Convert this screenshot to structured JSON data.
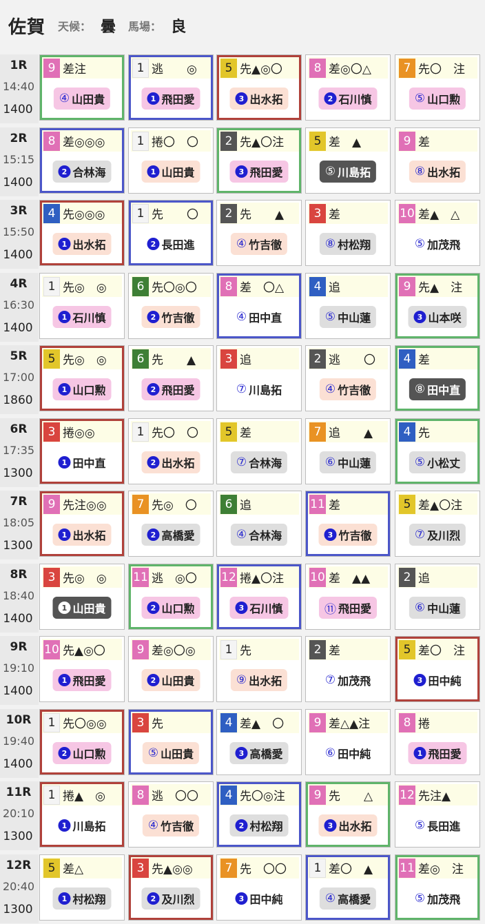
{
  "header": {
    "venue": "佐賀",
    "weather_label": "天候：",
    "weather": "曇",
    "track_label": "馬場：",
    "track": "良"
  },
  "races": [
    {
      "num": "1R",
      "time": "14:40",
      "dist": "1400",
      "entries": [
        {
          "frame": "green",
          "post": "9",
          "marks": "差注",
          "jockey_num": "④",
          "circle": "open",
          "jockey": "山田貴",
          "bg": "pink"
        },
        {
          "frame": "blue",
          "post": "1",
          "marks": "逃　　◎",
          "jockey_num": "1",
          "circle": "solid",
          "jockey": "飛田愛",
          "bg": "pink"
        },
        {
          "frame": "red",
          "post": "5",
          "marks": "先▲◎〇",
          "jockey_num": "3",
          "circle": "solid",
          "jockey": "出水拓",
          "bg": "peach"
        },
        {
          "frame": "none",
          "post": "8",
          "marks": "差◎〇△",
          "jockey_num": "2",
          "circle": "solid",
          "jockey": "石川慎",
          "bg": "pink"
        },
        {
          "frame": "none",
          "post": "7",
          "marks": "先〇　注",
          "jockey_num": "⑤",
          "circle": "open",
          "jockey": "山口勲",
          "bg": "pink"
        }
      ]
    },
    {
      "num": "2R",
      "time": "15:15",
      "dist": "1400",
      "entries": [
        {
          "frame": "blue",
          "post": "8",
          "marks": "差◎◎◎",
          "jockey_num": "2",
          "circle": "solid",
          "jockey": "合林海",
          "bg": "gray"
        },
        {
          "frame": "none",
          "post": "1",
          "marks": "捲〇　〇",
          "jockey_num": "1",
          "circle": "solid",
          "jockey": "山田貴",
          "bg": "peach"
        },
        {
          "frame": "green",
          "post": "2",
          "marks": "先▲〇注",
          "jockey_num": "3",
          "circle": "solid",
          "jockey": "飛田愛",
          "bg": "pink"
        },
        {
          "frame": "none",
          "post": "5",
          "marks": "差　▲",
          "jockey_num": "⑤",
          "circle": "open",
          "jockey": "川島拓",
          "bg": "dark"
        },
        {
          "frame": "none",
          "post": "9",
          "marks": "差",
          "jockey_num": "⑧",
          "circle": "open",
          "jockey": "出水拓",
          "bg": "peach"
        }
      ]
    },
    {
      "num": "3R",
      "time": "15:50",
      "dist": "1400",
      "entries": [
        {
          "frame": "red",
          "post": "4",
          "marks": "先◎◎◎",
          "jockey_num": "1",
          "circle": "solid",
          "jockey": "出水拓",
          "bg": "peach"
        },
        {
          "frame": "blue",
          "post": "1",
          "marks": "先　　〇",
          "jockey_num": "2",
          "circle": "solid",
          "jockey": "長田進",
          "bg": "white"
        },
        {
          "frame": "none",
          "post": "2",
          "marks": "先　　▲",
          "jockey_num": "④",
          "circle": "open",
          "jockey": "竹吉徹",
          "bg": "peach"
        },
        {
          "frame": "none",
          "post": "3",
          "marks": "差",
          "jockey_num": "⑧",
          "circle": "open",
          "jockey": "村松翔",
          "bg": "gray"
        },
        {
          "frame": "none",
          "post": "10",
          "marks": "差▲　△",
          "jockey_num": "⑤",
          "circle": "open",
          "jockey": "加茂飛",
          "bg": "none"
        }
      ]
    },
    {
      "num": "4R",
      "time": "16:30",
      "dist": "1400",
      "entries": [
        {
          "frame": "none",
          "post": "1",
          "marks": "先◎　◎",
          "jockey_num": "1",
          "circle": "solid",
          "jockey": "石川慎",
          "bg": "pink"
        },
        {
          "frame": "none",
          "post": "6",
          "marks": "先〇◎〇",
          "jockey_num": "2",
          "circle": "solid",
          "jockey": "竹吉徹",
          "bg": "peach"
        },
        {
          "frame": "blue",
          "post": "8",
          "marks": "差　〇△",
          "jockey_num": "④",
          "circle": "open",
          "jockey": "田中直",
          "bg": "white"
        },
        {
          "frame": "none",
          "post": "4",
          "marks": "追",
          "jockey_num": "⑤",
          "circle": "open",
          "jockey": "中山蓮",
          "bg": "gray"
        },
        {
          "frame": "green",
          "post": "9",
          "marks": "先▲　注",
          "jockey_num": "3",
          "circle": "solid",
          "jockey": "山本咲",
          "bg": "gray"
        }
      ]
    },
    {
      "num": "5R",
      "time": "17:00",
      "dist": "1860",
      "entries": [
        {
          "frame": "red",
          "post": "5",
          "marks": "先◎　◎",
          "jockey_num": "1",
          "circle": "solid",
          "jockey": "山口勲",
          "bg": "pink"
        },
        {
          "frame": "none",
          "post": "6",
          "marks": "先　　▲",
          "jockey_num": "2",
          "circle": "solid",
          "jockey": "飛田愛",
          "bg": "pink"
        },
        {
          "frame": "none",
          "post": "3",
          "marks": "追",
          "jockey_num": "⑦",
          "circle": "open",
          "jockey": "川島拓",
          "bg": "none"
        },
        {
          "frame": "none",
          "post": "2",
          "marks": "逃　　〇",
          "jockey_num": "④",
          "circle": "open",
          "jockey": "竹吉徹",
          "bg": "peach"
        },
        {
          "frame": "green",
          "post": "4",
          "marks": "差",
          "jockey_num": "⑧",
          "circle": "open",
          "jockey": "田中直",
          "bg": "dark"
        }
      ]
    },
    {
      "num": "6R",
      "time": "17:35",
      "dist": "1300",
      "entries": [
        {
          "frame": "red",
          "post": "3",
          "marks": "捲◎◎",
          "jockey_num": "1",
          "circle": "solid",
          "jockey": "田中直",
          "bg": "white"
        },
        {
          "frame": "none",
          "post": "1",
          "marks": "先〇　〇",
          "jockey_num": "2",
          "circle": "solid",
          "jockey": "出水拓",
          "bg": "peach"
        },
        {
          "frame": "none",
          "post": "5",
          "marks": "差",
          "jockey_num": "⑦",
          "circle": "open",
          "jockey": "合林海",
          "bg": "gray"
        },
        {
          "frame": "none",
          "post": "7",
          "marks": "追　　▲",
          "jockey_num": "⑥",
          "circle": "open",
          "jockey": "中山蓮",
          "bg": "gray"
        },
        {
          "frame": "green",
          "post": "4",
          "marks": "先",
          "jockey_num": "⑤",
          "circle": "open",
          "jockey": "小松丈",
          "bg": "gray"
        }
      ]
    },
    {
      "num": "7R",
      "time": "18:05",
      "dist": "1300",
      "entries": [
        {
          "frame": "red",
          "post": "9",
          "marks": "先注◎◎",
          "jockey_num": "1",
          "circle": "solid",
          "jockey": "出水拓",
          "bg": "peach"
        },
        {
          "frame": "none",
          "post": "7",
          "marks": "先◎　〇",
          "jockey_num": "2",
          "circle": "solid",
          "jockey": "高橋愛",
          "bg": "gray"
        },
        {
          "frame": "none",
          "post": "6",
          "marks": "追",
          "jockey_num": "④",
          "circle": "open",
          "jockey": "合林海",
          "bg": "gray"
        },
        {
          "frame": "blue",
          "post": "11",
          "marks": "差",
          "jockey_num": "3",
          "circle": "solid",
          "jockey": "竹吉徹",
          "bg": "peach"
        },
        {
          "frame": "none",
          "post": "5",
          "marks": "差▲〇注",
          "jockey_num": "⑦",
          "circle": "open",
          "jockey": "及川烈",
          "bg": "gray"
        }
      ]
    },
    {
      "num": "8R",
      "time": "18:40",
      "dist": "1400",
      "entries": [
        {
          "frame": "none",
          "post": "3",
          "marks": "先◎　◎",
          "jockey_num": "1",
          "circle": "solid",
          "jockey": "山田貴",
          "bg": "dark"
        },
        {
          "frame": "green",
          "post": "11",
          "marks": "逃　◎〇",
          "jockey_num": "2",
          "circle": "solid",
          "jockey": "山口勲",
          "bg": "pink"
        },
        {
          "frame": "blue",
          "post": "12",
          "marks": "捲▲〇注",
          "jockey_num": "3",
          "circle": "solid",
          "jockey": "石川慎",
          "bg": "pink"
        },
        {
          "frame": "none",
          "post": "10",
          "marks": "差　▲▲",
          "jockey_num": "⑪",
          "circle": "open",
          "jockey": "飛田愛",
          "bg": "pink"
        },
        {
          "frame": "none",
          "post": "2",
          "marks": "追",
          "jockey_num": "⑥",
          "circle": "open",
          "jockey": "中山蓮",
          "bg": "gray"
        }
      ]
    },
    {
      "num": "9R",
      "time": "19:10",
      "dist": "1400",
      "entries": [
        {
          "frame": "none",
          "post": "10",
          "marks": "先▲◎〇",
          "jockey_num": "1",
          "circle": "solid",
          "jockey": "飛田愛",
          "bg": "pink"
        },
        {
          "frame": "none",
          "post": "9",
          "marks": "差◎〇◎",
          "jockey_num": "2",
          "circle": "solid",
          "jockey": "山田貴",
          "bg": "peach"
        },
        {
          "frame": "none",
          "post": "1",
          "marks": "先",
          "jockey_num": "⑨",
          "circle": "open",
          "jockey": "出水拓",
          "bg": "peach"
        },
        {
          "frame": "none",
          "post": "2",
          "marks": "差",
          "jockey_num": "⑦",
          "circle": "open",
          "jockey": "加茂飛",
          "bg": "none"
        },
        {
          "frame": "red",
          "post": "5",
          "marks": "差〇　注",
          "jockey_num": "3",
          "circle": "solid",
          "jockey": "田中純",
          "bg": "white"
        }
      ]
    },
    {
      "num": "10R",
      "time": "19:40",
      "dist": "1400",
      "entries": [
        {
          "frame": "red",
          "post": "1",
          "marks": "先〇◎◎",
          "jockey_num": "2",
          "circle": "solid",
          "jockey": "山口勲",
          "bg": "pink"
        },
        {
          "frame": "blue",
          "post": "3",
          "marks": "先",
          "jockey_num": "⑤",
          "circle": "open",
          "jockey": "山田貴",
          "bg": "peach"
        },
        {
          "frame": "none",
          "post": "4",
          "marks": "差▲　〇",
          "jockey_num": "3",
          "circle": "solid",
          "jockey": "高橋愛",
          "bg": "gray"
        },
        {
          "frame": "none",
          "post": "9",
          "marks": "差△▲注",
          "jockey_num": "⑥",
          "circle": "open",
          "jockey": "田中純",
          "bg": "none"
        },
        {
          "frame": "none",
          "post": "8",
          "marks": "捲",
          "jockey_num": "1",
          "circle": "solid",
          "jockey": "飛田愛",
          "bg": "pink"
        }
      ]
    },
    {
      "num": "11R",
      "time": "20:10",
      "dist": "1300",
      "entries": [
        {
          "frame": "red",
          "post": "1",
          "marks": "捲▲　◎",
          "jockey_num": "1",
          "circle": "solid",
          "jockey": "川島拓",
          "bg": "white"
        },
        {
          "frame": "none",
          "post": "8",
          "marks": "逃　〇〇",
          "jockey_num": "④",
          "circle": "open",
          "jockey": "竹吉徹",
          "bg": "peach"
        },
        {
          "frame": "blue",
          "post": "4",
          "marks": "先〇◎注",
          "jockey_num": "2",
          "circle": "solid",
          "jockey": "村松翔",
          "bg": "gray"
        },
        {
          "frame": "green",
          "post": "9",
          "marks": "先　　△",
          "jockey_num": "3",
          "circle": "solid",
          "jockey": "出水拓",
          "bg": "peach"
        },
        {
          "frame": "none",
          "post": "12",
          "marks": "先注▲",
          "jockey_num": "⑤",
          "circle": "open",
          "jockey": "長田進",
          "bg": "none"
        }
      ]
    },
    {
      "num": "12R",
      "time": "20:40",
      "dist": "1300",
      "entries": [
        {
          "frame": "none",
          "post": "5",
          "marks": "差△",
          "jockey_num": "1",
          "circle": "solid",
          "jockey": "村松翔",
          "bg": "gray"
        },
        {
          "frame": "red",
          "post": "3",
          "marks": "先▲◎◎",
          "jockey_num": "2",
          "circle": "solid",
          "jockey": "及川烈",
          "bg": "gray"
        },
        {
          "frame": "none",
          "post": "7",
          "marks": "先　〇〇",
          "jockey_num": "3",
          "circle": "solid",
          "jockey": "田中純",
          "bg": "none"
        },
        {
          "frame": "blue",
          "post": "1",
          "marks": "差〇　▲",
          "jockey_num": "④",
          "circle": "open",
          "jockey": "高橋愛",
          "bg": "gray"
        },
        {
          "frame": "green",
          "post": "11",
          "marks": "差◎　注",
          "jockey_num": "⑤",
          "circle": "open",
          "jockey": "加茂飛",
          "bg": "white"
        }
      ]
    }
  ],
  "post_colors": {
    "1": "b1",
    "2": "b2",
    "3": "b3",
    "4": "b4",
    "5": "b5",
    "6": "b6",
    "7": "b7",
    "8": "b8",
    "9": "b8",
    "10": "b8",
    "11": "b8",
    "12": "b8"
  },
  "colors": {
    "frame_green": "#5fb46a",
    "frame_blue": "#4b56c9",
    "frame_red": "#b0413a",
    "mark_row_bg": "#fdfde6",
    "circle_blue": "#1f1fd0"
  }
}
